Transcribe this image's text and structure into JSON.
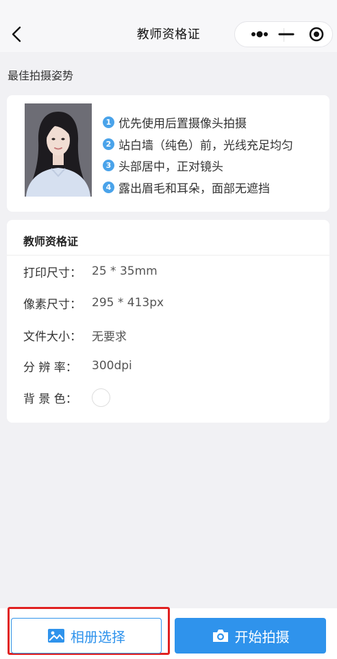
{
  "nav": {
    "title": "教师资格证"
  },
  "guide": {
    "heading": "最佳拍摄姿势",
    "tips": [
      {
        "num": "1",
        "text": "优先使用后置摄像头拍摄"
      },
      {
        "num": "2",
        "text": "站白墙（纯色）前，光线充足均匀"
      },
      {
        "num": "3",
        "text": "头部居中，正对镜头"
      },
      {
        "num": "4",
        "text": "露出眉毛和耳朵，面部无遮挡"
      }
    ]
  },
  "spec": {
    "title": "教师资格证",
    "rows": [
      {
        "label": "打印尺寸：",
        "value": "25 * 35mm"
      },
      {
        "label": "像素尺寸：",
        "value": "295 * 413px"
      },
      {
        "label": "文件大小：",
        "value": "无要求"
      },
      {
        "label": "分 辨 率：",
        "value": "300dpi"
      },
      {
        "label": "背 景 色："
      }
    ],
    "background_color": "#ffffff"
  },
  "actions": {
    "album_label": "相册选择",
    "shoot_label": "开始拍摄"
  },
  "colors": {
    "accent": "#2f93ec",
    "highlight": "#e02020",
    "tip_badge": "#4aa3ea"
  }
}
